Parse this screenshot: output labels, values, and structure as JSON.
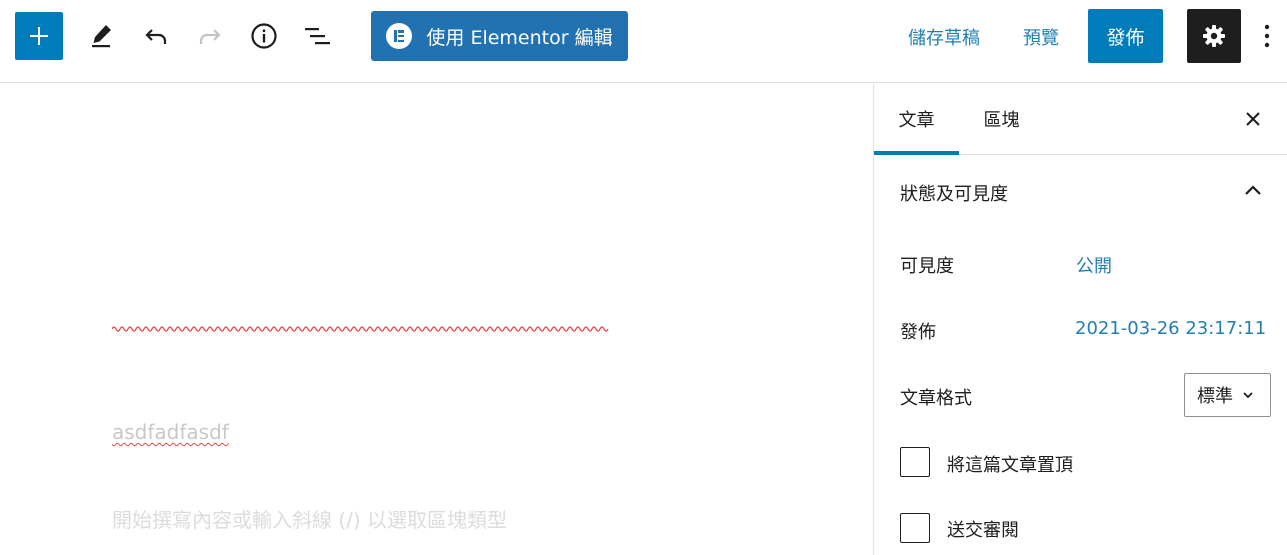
{
  "toolbar": {
    "inserter_icon": "plus-icon",
    "tools_icon": "pencil-icon",
    "undo_icon": "undo-icon",
    "redo_icon": "redo-icon",
    "info_icon": "info-icon",
    "outline_icon": "list-view-icon",
    "elementor_label": "使用 Elementor 編輯",
    "save_draft_label": "儲存草稿",
    "preview_label": "預覽",
    "publish_label": "發佈",
    "settings_icon": "gear-icon",
    "more_icon": "vertical-ellipsis-icon"
  },
  "editor": {
    "paragraph_text": "asdfadfasdf",
    "placeholder": "開始撰寫內容或輸入斜線 (/) 以選取區塊類型"
  },
  "sidebar": {
    "tabs": [
      {
        "label": "文章",
        "active": true
      },
      {
        "label": "區塊",
        "active": false
      }
    ],
    "panel_title": "狀態及可見度",
    "visibility_label": "可見度",
    "visibility_value": "公開",
    "publish_label": "發佈",
    "publish_value": "2021-03-26 23:17:11",
    "format_label": "文章格式",
    "format_value": "標準",
    "sticky_label": "將這篇文章置頂",
    "review_label": "送交審閱"
  },
  "colors": {
    "accent": "#007cba",
    "elementor": "#2271b1",
    "link": "#1f7fb4",
    "dark": "#1e1e1e"
  }
}
